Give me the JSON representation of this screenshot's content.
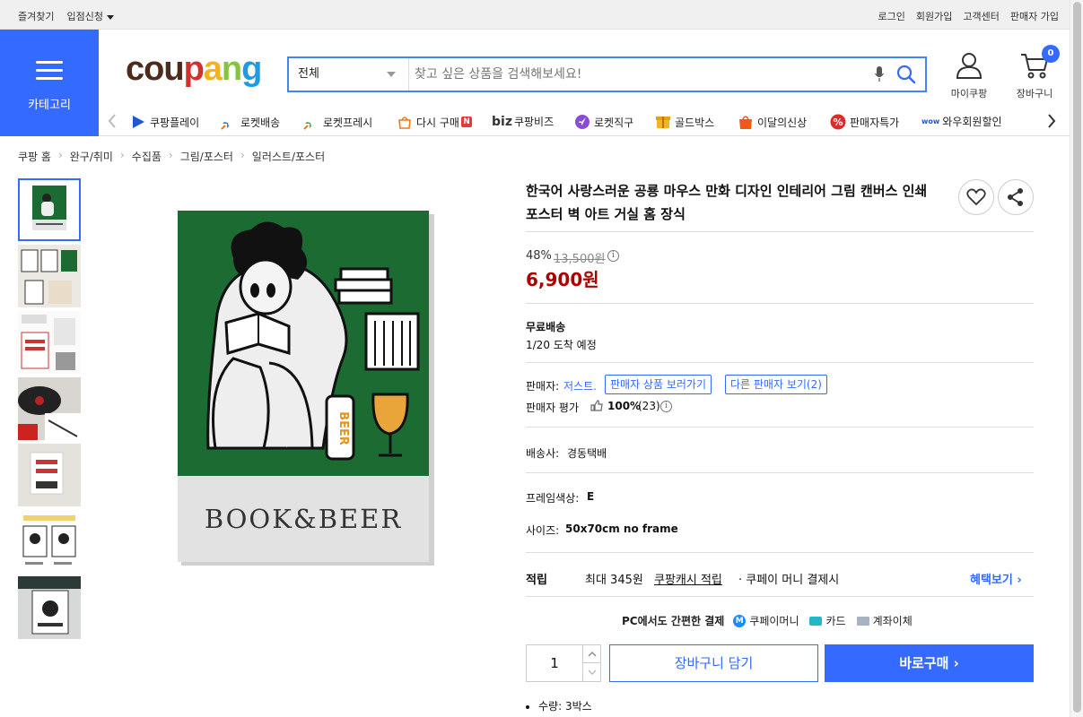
{
  "topbar": {
    "left": [
      "즐겨찾기",
      "입점신청"
    ],
    "right": [
      "로그인",
      "회원가입",
      "고객센터",
      "판매자 가입"
    ]
  },
  "category_button": {
    "label": "카테고리"
  },
  "logo": {
    "parts": [
      "cou",
      "p",
      "a",
      "n",
      "g"
    ]
  },
  "search": {
    "category": "전체",
    "placeholder": "찾고 싶은 상품을 검색해보세요!"
  },
  "header_actions": {
    "mypage": "마이쿠팡",
    "cart": "장바구니",
    "cart_count": "0"
  },
  "nav": {
    "items": [
      {
        "label": "쿠팡플레이",
        "icon": "play-icon"
      },
      {
        "label": "로켓배송",
        "icon": "rocket-icon"
      },
      {
        "label": "로켓프레시",
        "icon": "fresh-rocket-icon"
      },
      {
        "label": "다시 구매",
        "icon": "rebuy-icon",
        "badge": "N"
      },
      {
        "label": "쿠팡비즈",
        "prefix": "biz",
        "icon": "biz-icon"
      },
      {
        "label": "로켓직구",
        "icon": "global-rocket-icon"
      },
      {
        "label": "골드박스",
        "icon": "goldbox-icon"
      },
      {
        "label": "이달의신상",
        "icon": "new-bag-icon"
      },
      {
        "label": "판매자특가",
        "icon": "seller-deal-icon"
      },
      {
        "label": "와우회원할인",
        "icon": "wow-icon",
        "prefix": "wow"
      }
    ]
  },
  "breadcrumb": [
    "쿠팡 홈",
    "완구/취미",
    "수집품",
    "그림/포스터",
    "일러스트/포스터"
  ],
  "product": {
    "title": "한국어 사랑스러운 공룡 마우스 만화 디자인 인테리어 그림 캔버스 인쇄 포스터 벽 아트 거실 홈 장식",
    "poster_text": "BOOK&BEER",
    "can_text": "BEER",
    "discount": "48%",
    "original_price": "13,500원",
    "price": "6,900원",
    "shipping_label": "무료배송",
    "delivery": "1/20 도착 예정",
    "seller_label": "판매자:",
    "seller_name": "저스트.",
    "seller_products_btn": "판매자 상품 보러가기",
    "other_sellers_btn": "다른 판매자 보기(2)",
    "rating_label": "판매자 평가",
    "rating_pct": "100%",
    "rating_count": "(23)",
    "courier_label": "배송사:",
    "courier": "경동택배",
    "frame_color_label": "프레임색상:",
    "frame_color": "E",
    "size_label": "사이즈:",
    "size": "50x70cm no frame",
    "reward_label": "적립",
    "reward_amount": "최대 345원",
    "reward_link": "쿠팡캐시 적립",
    "reward_tail": "· 쿠페이 머니 결제시",
    "benefit_link": "혜택보기",
    "pay_label": "PC에서도 간편한 결제",
    "pay_methods": [
      "쿠페이머니",
      "카드",
      "계좌이체"
    ],
    "quantity": "1",
    "add_to_cart": "장바구니 담기",
    "buy_now": "바로구매",
    "bullet_1": "수량: 3박스"
  },
  "colors": {
    "accent": "#346aff",
    "price_red": "#ae0000",
    "poster_green": "#1b6b33"
  }
}
